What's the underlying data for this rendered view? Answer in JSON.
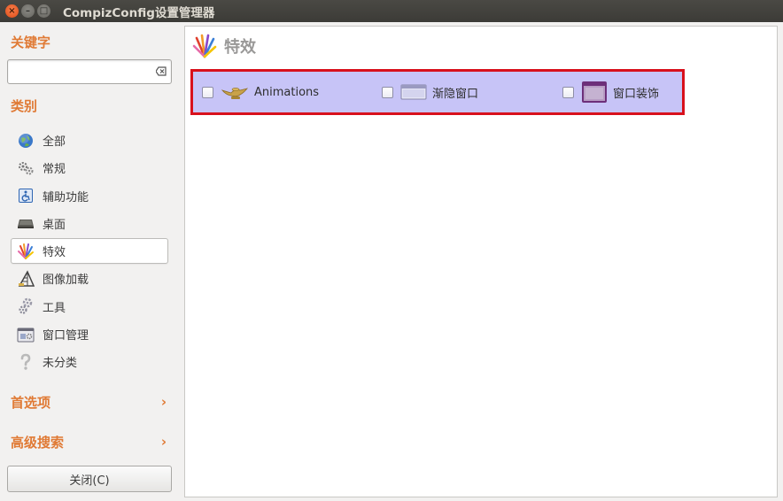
{
  "window": {
    "title": "CompizConfig设置管理器",
    "controls": [
      "close-icon",
      "minimize-icon",
      "maximize-icon"
    ]
  },
  "sidebar": {
    "filter_title": "关键字",
    "search": {
      "value": "",
      "placeholder": ""
    },
    "categories_title": "类别",
    "categories": [
      {
        "label": "全部",
        "icon": "globe-icon"
      },
      {
        "label": "常规",
        "icon": "gears-icon"
      },
      {
        "label": "辅助功能",
        "icon": "accessibility-icon"
      },
      {
        "label": "桌面",
        "icon": "desktop-icon"
      },
      {
        "label": "特效",
        "icon": "effects-icon",
        "selected": true
      },
      {
        "label": "图像加载",
        "icon": "image-loading-icon"
      },
      {
        "label": "工具",
        "icon": "tools-icon"
      },
      {
        "label": "窗口管理",
        "icon": "window-management-icon"
      },
      {
        "label": "未分类",
        "icon": "uncategorized-icon"
      }
    ],
    "preferences_label": "首选项",
    "advanced_search_label": "高级搜索",
    "close_button": "关闭(C)"
  },
  "content": {
    "title": "特效",
    "plugins": [
      {
        "label": "Animations",
        "checked": false,
        "icon": "lamp-icon"
      },
      {
        "label": "渐隐窗口",
        "checked": false,
        "icon": "window-fade-icon"
      },
      {
        "label": "窗口装饰",
        "checked": false,
        "icon": "window-decoration-icon"
      }
    ]
  },
  "colors": {
    "accent": "#e07a35",
    "highlight_border": "#d8101c",
    "plugin_row_bg": "#c7c4f7",
    "titlebar": "#3c3b37"
  }
}
